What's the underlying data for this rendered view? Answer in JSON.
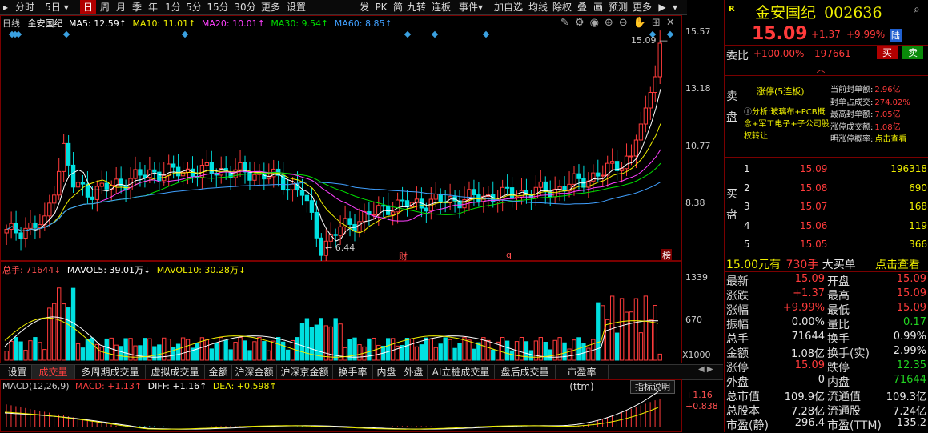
{
  "toolbar": {
    "left": [
      "分时",
      "5日",
      "日",
      "周",
      "月",
      "季",
      "年",
      "1分",
      "5分",
      "15分",
      "30分",
      "更多",
      "设置"
    ],
    "right": [
      "发",
      "PK",
      "简",
      "九转",
      "连板",
      "事件",
      "加自选",
      "均线",
      "除权",
      "叠",
      "画",
      "预测",
      "更多"
    ],
    "active": "日"
  },
  "kline": {
    "period_label": "日线",
    "stock_name": "金安国纪",
    "ma": [
      {
        "label": "MA5: 12.59↑",
        "color": "#ffffff"
      },
      {
        "label": "MA10: 11.01↑",
        "color": "#f0f000"
      },
      {
        "label": "MA20: 10.01↑",
        "color": "#ff40ff"
      },
      {
        "label": "MA30: 9.54↑",
        "color": "#00e000"
      },
      {
        "label": "MA60: 8.85↑",
        "color": "#40a0ff"
      }
    ],
    "y_ticks": [
      "15.57",
      "13.18",
      "10.77",
      "8.38"
    ],
    "high_label": "15.09",
    "low_label": "6.44",
    "markers": [
      "财",
      "q",
      "榜"
    ]
  },
  "volume": {
    "total_label": "总手: 71644↓",
    "mavol5": "MAVOL5: 39.01万↓",
    "mavol10": "MAVOL10: 30.28万↓",
    "y_ticks": [
      "1339",
      "670",
      "X1000"
    ]
  },
  "tabs": [
    "设置",
    "成交量",
    "多周期成交量",
    "虚拟成交量",
    "金额",
    "沪深金额",
    "沪深京金额",
    "换手率",
    "内盘",
    "外盘",
    "AI立桩成交量",
    "盘后成交量",
    "市盈率(ttm)"
  ],
  "tabs_active": "成交量",
  "macd": {
    "title": "MACD(12,26,9)",
    "macd": "MACD: +1.13↑",
    "diff": "DIFF: +1.16↑",
    "dea": "DEA: +0.598↑",
    "help": "指标说明",
    "y_ticks": [
      "+1.16",
      "+0.838"
    ]
  },
  "quote": {
    "badge": "R",
    "name": "金安国纪",
    "code": "002636",
    "price": "15.09",
    "change": "+1.37",
    "pct": "+9.99%",
    "tag": "陆",
    "weibi_label": "委比",
    "weibi": "+100.00%",
    "weicha": "197661",
    "buy": "买",
    "sell": "卖",
    "sell_side_label": "卖盘",
    "limit_title": "涨停(5连板)",
    "analysis": "分析:玻璃布+PCB概念+军工电子+子公司股权转让",
    "limit_stats": [
      {
        "k": "当前封单额:",
        "v": "2.96亿"
      },
      {
        "k": "封单占成交:",
        "v": "274.02%"
      },
      {
        "k": "最高封单额:",
        "v": "7.05亿"
      },
      {
        "k": "涨停成交额:",
        "v": "1.08亿"
      },
      {
        "k": "明涨停概率:",
        "v": "点击查看"
      }
    ],
    "buy_side_label": "买盘",
    "bids": [
      {
        "lvl": "1",
        "price": "15.09",
        "vol": "196318"
      },
      {
        "lvl": "2",
        "price": "15.08",
        "vol": "690"
      },
      {
        "lvl": "3",
        "price": "15.07",
        "vol": "168"
      },
      {
        "lvl": "4",
        "price": "15.06",
        "vol": "119"
      },
      {
        "lvl": "5",
        "price": "15.05",
        "vol": "366"
      }
    ],
    "bigbuy": {
      "price": "15.00元有",
      "vol": "730手",
      "label": "大买单",
      "link": "点击查看"
    },
    "stats": [
      {
        "k1": "最新",
        "v1": "15.09",
        "k2": "开盘",
        "v2": "15.09"
      },
      {
        "k1": "涨跌",
        "v1": "+1.37",
        "k2": "最高",
        "v2": "15.09"
      },
      {
        "k1": "涨幅",
        "v1": "+9.99%",
        "k2": "最低",
        "v2": "15.09"
      },
      {
        "k1": "振幅",
        "v1": "0.00%",
        "k2": "量比",
        "v2": "0.17"
      },
      {
        "k1": "总手",
        "v1": "71644",
        "k2": "换手",
        "v2": "0.99%"
      },
      {
        "k1": "金额",
        "v1": "1.08亿",
        "k2": "换手(实)",
        "v2": "2.99%"
      },
      {
        "k1": "涨停",
        "v1": "15.09",
        "k2": "跌停",
        "v2": "12.35"
      },
      {
        "k1": "外盘",
        "v1": "0",
        "k2": "内盘",
        "v2": "71644"
      },
      {
        "k1": "总市值",
        "v1": "109.9亿",
        "k2": "流通值",
        "v2": "109.3亿"
      },
      {
        "k1": "总股本",
        "v1": "7.28亿",
        "k2": "流通股",
        "v2": "7.24亿"
      },
      {
        "k1": "市盈(静)",
        "v1": "296.4",
        "k2": "市盈(TTM)",
        "v2": "135.2"
      }
    ]
  },
  "colors": {
    "up": "#ff3b3b",
    "down": "#00e0e0",
    "border": "#7a0000",
    "ma5": "#ffffff",
    "ma10": "#f0f000",
    "ma20": "#ff40ff",
    "ma30": "#00e000",
    "ma60": "#40a0ff"
  }
}
